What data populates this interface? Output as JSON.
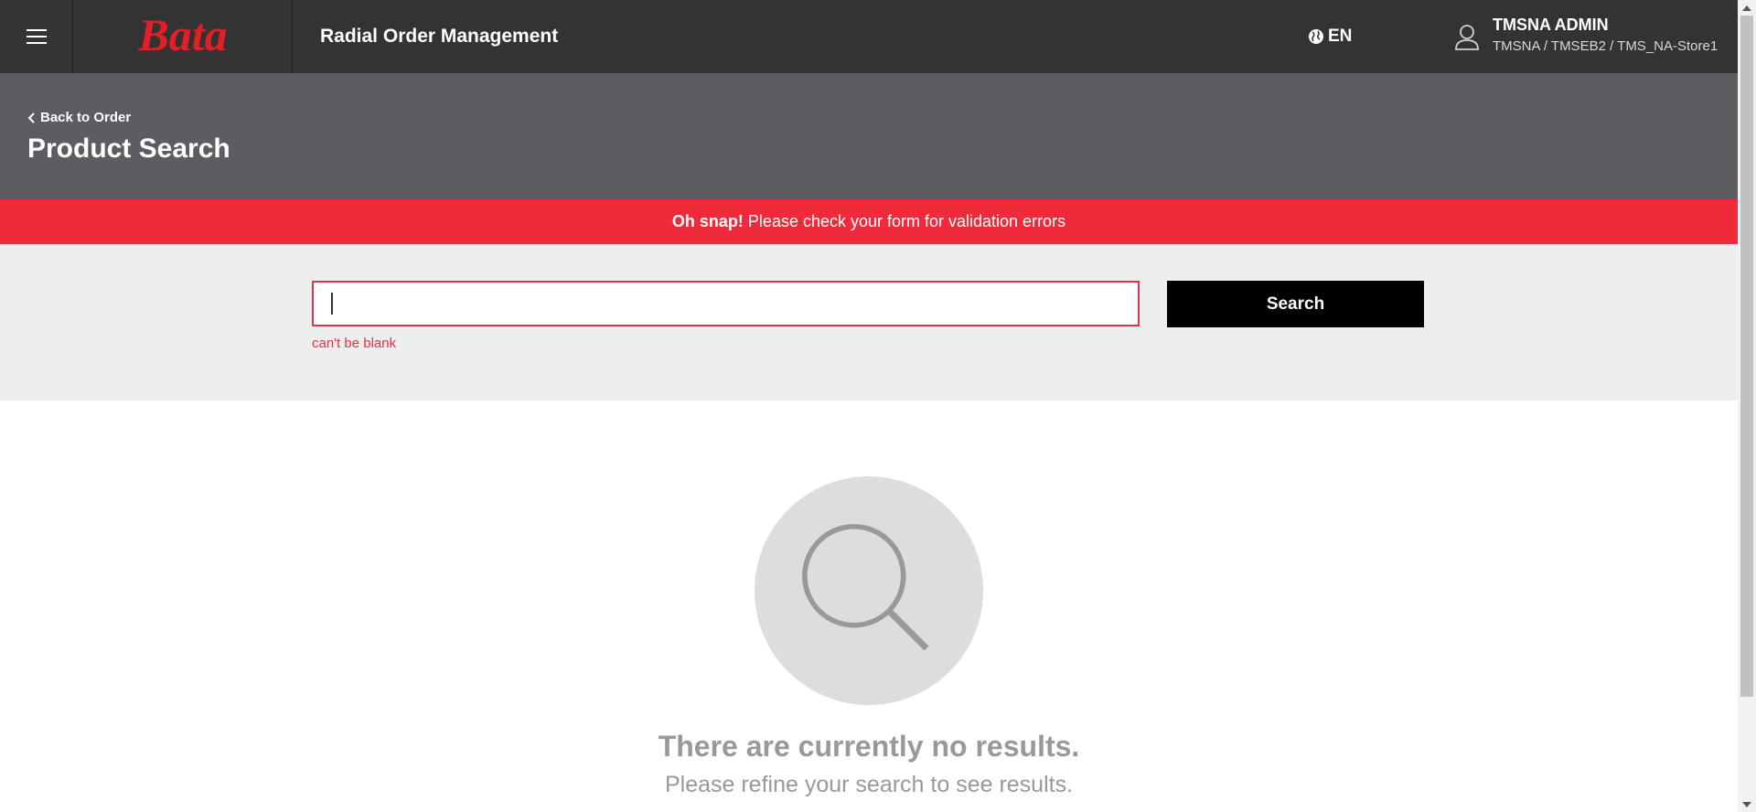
{
  "header": {
    "brand": "Bata",
    "app_title": "Radial Order Management",
    "language": "EN",
    "user_name": "TMSNA ADMIN",
    "user_location": "TMSNA / TMSEB2 / TMS_NA-Store1"
  },
  "page": {
    "back_label": "Back to Order",
    "title": "Product Search"
  },
  "alert": {
    "strong": "Oh snap!",
    "message": "Please check your form for validation errors"
  },
  "search": {
    "value": "",
    "error": "can't be blank",
    "button_label": "Search"
  },
  "empty_state": {
    "title": "There are currently no results.",
    "subtitle": "Please refine your search to see results."
  },
  "colors": {
    "brand_red": "#e31e24",
    "alert_red": "#ee2a3b",
    "topbar": "#333333",
    "header": "#5c5c61"
  }
}
